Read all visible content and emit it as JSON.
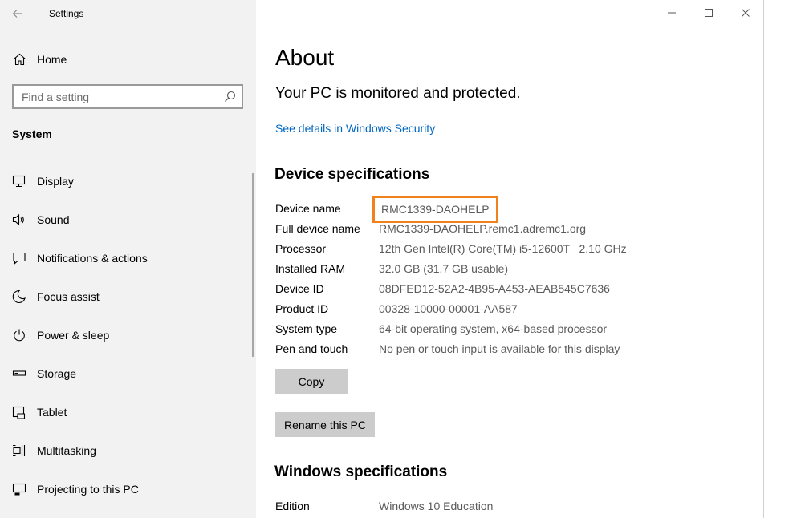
{
  "window": {
    "app_title": "Settings"
  },
  "sidebar": {
    "home_label": "Home",
    "search": {
      "placeholder": "Find a setting"
    },
    "section_title": "System",
    "items": [
      {
        "label": "Display",
        "icon": "monitor-icon"
      },
      {
        "label": "Sound",
        "icon": "speaker-icon"
      },
      {
        "label": "Notifications & actions",
        "icon": "notification-icon"
      },
      {
        "label": "Focus assist",
        "icon": "moon-icon"
      },
      {
        "label": "Power & sleep",
        "icon": "power-icon"
      },
      {
        "label": "Storage",
        "icon": "storage-icon"
      },
      {
        "label": "Tablet",
        "icon": "tablet-icon"
      },
      {
        "label": "Multitasking",
        "icon": "multitasking-icon"
      },
      {
        "label": "Projecting to this PC",
        "icon": "projecting-icon"
      }
    ]
  },
  "main": {
    "page_title": "About",
    "protected_message": "Your PC is monitored and protected.",
    "security_link": "See details in Windows Security",
    "device_specs": {
      "heading": "Device specifications",
      "rows": [
        {
          "label": "Device name",
          "value": "RMC1339-DAOHELP"
        },
        {
          "label": "Full device name",
          "value": "RMC1339-DAOHELP.remc1.adremc1.org"
        },
        {
          "label": "Processor",
          "value": "12th Gen Intel(R) Core(TM) i5-12600T   2.10 GHz"
        },
        {
          "label": "Installed RAM",
          "value": "32.0 GB (31.7 GB usable)"
        },
        {
          "label": "Device ID",
          "value": "08DFED12-52A2-4B95-A453-AEAB545C7636"
        },
        {
          "label": "Product ID",
          "value": "00328-10000-00001-AA587"
        },
        {
          "label": "System type",
          "value": "64-bit operating system, x64-based processor"
        },
        {
          "label": "Pen and touch",
          "value": "No pen or touch input is available for this display"
        }
      ],
      "copy_button": "Copy",
      "rename_button": "Rename this PC"
    },
    "windows_specs": {
      "heading": "Windows specifications",
      "rows": [
        {
          "label": "Edition",
          "value": "Windows 10 Education"
        }
      ]
    }
  },
  "colors": {
    "sidebar_bg": "#f2f2f2",
    "link": "#0067c0",
    "highlight_border": "#f0821e",
    "button_bg": "#cccccc"
  }
}
